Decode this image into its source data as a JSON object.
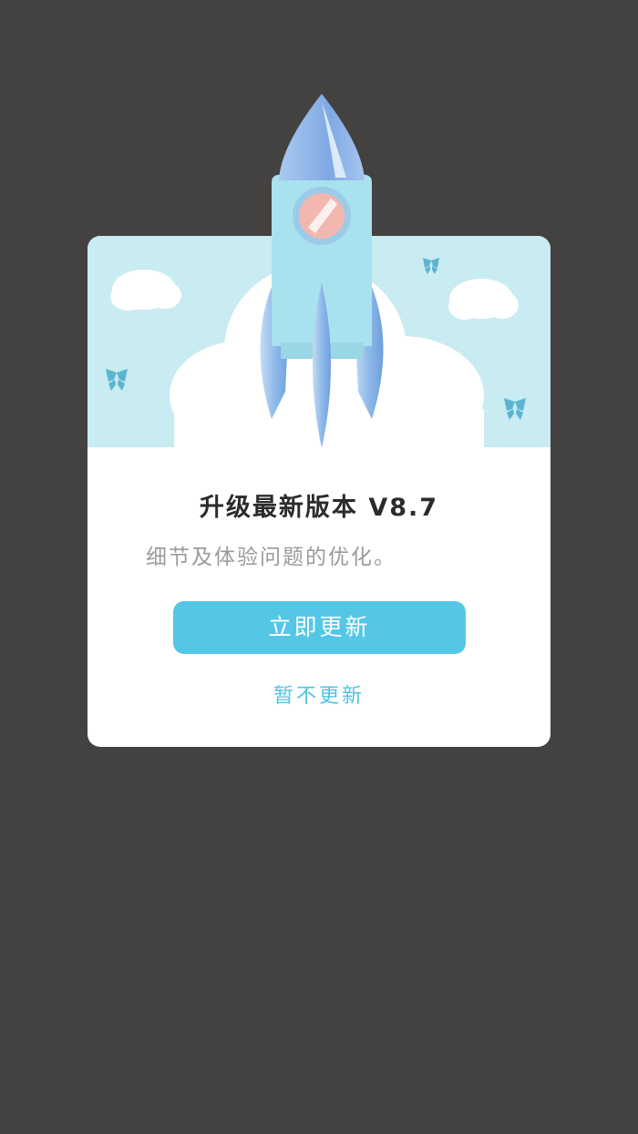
{
  "dialog": {
    "title": "升级最新版本 V8.7",
    "description": "细节及体验问题的优化。",
    "update_button_label": "立即更新",
    "later_label": "暂不更新"
  },
  "colors": {
    "overlay": "#434241",
    "sky": "#c9ebf2",
    "accent": "#55c7e6",
    "butterfly": "#5bb5d0"
  },
  "icons": [
    "rocket-icon",
    "cloud-icon",
    "butterfly-icon"
  ]
}
